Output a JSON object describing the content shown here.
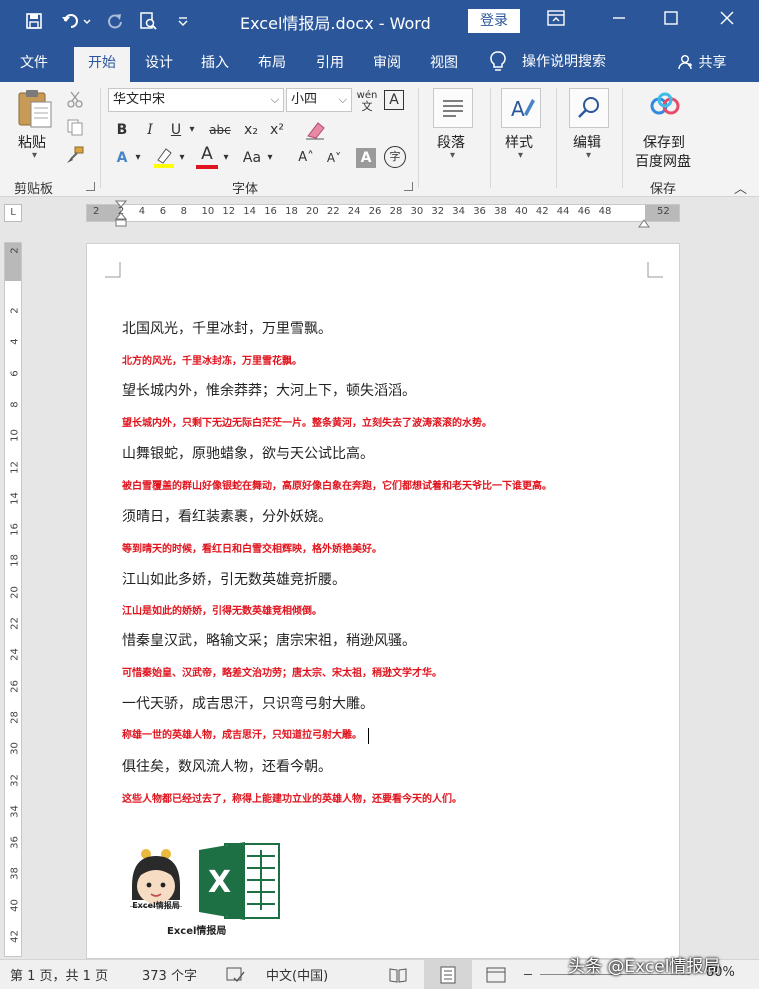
{
  "titlebar": {
    "title": "Excel情报局.docx  -  Word",
    "login": "登录"
  },
  "tabs": [
    "文件",
    "开始",
    "设计",
    "插入",
    "布局",
    "引用",
    "审阅",
    "视图"
  ],
  "tellme": "操作说明搜索",
  "share": "共享",
  "ribbon": {
    "paste": "粘贴",
    "clipboard": "剪贴板",
    "font_name": "华文中宋",
    "font_size": "小四",
    "font_group": "字体",
    "paragraph": "段落",
    "styles": "样式",
    "editing": "编辑",
    "save_to_1": "保存到",
    "save_to_2": "百度网盘",
    "save_group": "保存",
    "bold": "B",
    "italic": "I",
    "underline": "U",
    "strike": "abc",
    "subscript": "x₂",
    "superscript": "x²",
    "grow": "A˄",
    "shrink": "A˅",
    "change_case": "Aa",
    "phonetic": "wén",
    "char_border": "A",
    "char_shade": "A",
    "enclose": "字"
  },
  "ruler": {
    "corner": "L",
    "numbers": [
      "2",
      "2",
      "4",
      "6",
      "8",
      "10",
      "12",
      "14",
      "16",
      "18",
      "20",
      "22",
      "24",
      "26",
      "28",
      "30",
      "32",
      "34",
      "36",
      "38",
      "40",
      "42",
      "44",
      "46",
      "48",
      "52"
    ],
    "vnumbers": [
      "2",
      "2",
      "4",
      "6",
      "8",
      "10",
      "12",
      "14",
      "16",
      "18",
      "20",
      "22",
      "24",
      "26",
      "28",
      "30",
      "32",
      "34",
      "36",
      "38",
      "40",
      "42"
    ]
  },
  "document": {
    "lines": [
      {
        "style": "black",
        "text": "北国风光，千里冰封，万里雪飘。"
      },
      {
        "style": "red",
        "text": "北方的风光，千里冰封冻，万里雪花飘。"
      },
      {
        "style": "black",
        "text": "望长城内外，惟余莽莽；大河上下，顿失滔滔。"
      },
      {
        "style": "red",
        "text": "望长城内外，只剩下无边无际白茫茫一片。整条黄河，立刻失去了波涛滚滚的水势。"
      },
      {
        "style": "black",
        "text": "山舞银蛇，原驰蜡象，欲与天公试比高。"
      },
      {
        "style": "red",
        "text": "被白雪覆盖的群山好像银蛇在舞动，高原好像白象在奔跑，它们都想试着和老天爷比一下谁更高。"
      },
      {
        "style": "black",
        "text": "须晴日，看红装素裹，分外妖娆。"
      },
      {
        "style": "red",
        "text": "等到晴天的时候，看红日和白雪交相辉映，格外娇艳美好。"
      },
      {
        "style": "black",
        "text": "江山如此多娇，引无数英雄竞折腰。"
      },
      {
        "style": "red",
        "text": "江山是如此的娇娇，引得无数英雄竞相倾倒。"
      },
      {
        "style": "black",
        "text": "惜秦皇汉武，略输文采；唐宗宋祖，稍逊风骚。"
      },
      {
        "style": "red",
        "text": "可惜秦始皇、汉武帝，略差文治功劳；唐太宗、宋太祖，稍逊文学才华。"
      },
      {
        "style": "black",
        "text": "一代天骄，成吉思汗，只识弯弓射大雕。"
      },
      {
        "style": "red",
        "text": "称雄一世的英雄人物，成吉思汗，只知道拉弓射大雕。"
      },
      {
        "style": "black",
        "text": "俱往矣，数风流人物，还看今朝。"
      },
      {
        "style": "red",
        "text": "这些人物都已经过去了，称得上能建功立业的英雄人物，还要看今天的人们。"
      }
    ],
    "avatar_caption": "Excel情报局",
    "logo_caption": "Excel情报局"
  },
  "status": {
    "page": "第 1 页，共 1 页",
    "words": "373 个字",
    "lang": "中文(中国)",
    "zoom": "80%"
  },
  "watermark": "头条 @Excel情报局",
  "colors": {
    "brand": "#2b579a",
    "red_text": "#e0141e",
    "excel_green": "#1d7044"
  }
}
